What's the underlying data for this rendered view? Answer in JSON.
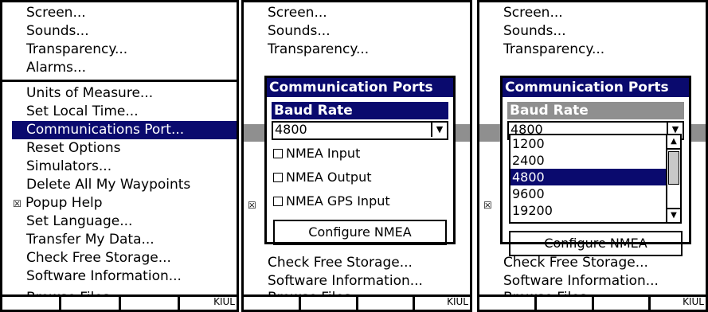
{
  "panel1": {
    "menu_top": [
      "Screen...",
      "Sounds...",
      "Transparency...",
      "Alarms..."
    ],
    "menu_main": [
      "Units of Measure...",
      "Set Local Time...",
      "Communications Port...",
      "Reset Options",
      "Simulators...",
      "Delete All My Waypoints",
      "Popup Help",
      "Set Language...",
      "Transfer My Data...",
      "Check Free Storage...",
      "Software Information..."
    ],
    "popup_help_check": "☒",
    "clipped": "Browse Files...",
    "bottom_right": "KIUL"
  },
  "panel2": {
    "menu_top": [
      "Screen...",
      "Sounds...",
      "Transparency..."
    ],
    "menu_bottom": [
      "Check Free Storage...",
      "Software Information..."
    ],
    "clipped": "Browse Files...",
    "side_check": "☒",
    "bottom_right": "KIUL",
    "dialog": {
      "title": "Communication Ports",
      "field_label": "Baud Rate",
      "baud_value": "4800",
      "options": [
        "NMEA Input",
        "NMEA Output",
        "NMEA GPS Input"
      ],
      "button": "Configure NMEA"
    }
  },
  "panel3": {
    "menu_top": [
      "Screen...",
      "Sounds...",
      "Transparency..."
    ],
    "menu_bottom": [
      "Check Free Storage...",
      "Software Information..."
    ],
    "clipped": "Browse Files...",
    "side_check": "☒",
    "bottom_right": "KIUL",
    "dialog": {
      "title": "Communication Ports",
      "field_label": "Baud Rate",
      "baud_value": "4800",
      "list": [
        "1200",
        "2400",
        "4800",
        "9600",
        "19200"
      ],
      "selected": "4800",
      "button": "Configure NMEA"
    }
  },
  "colors": {
    "highlight": "#0a0a6e",
    "disabled_label": "#8f8f8f",
    "grey_bar": "#8f8f8f"
  }
}
